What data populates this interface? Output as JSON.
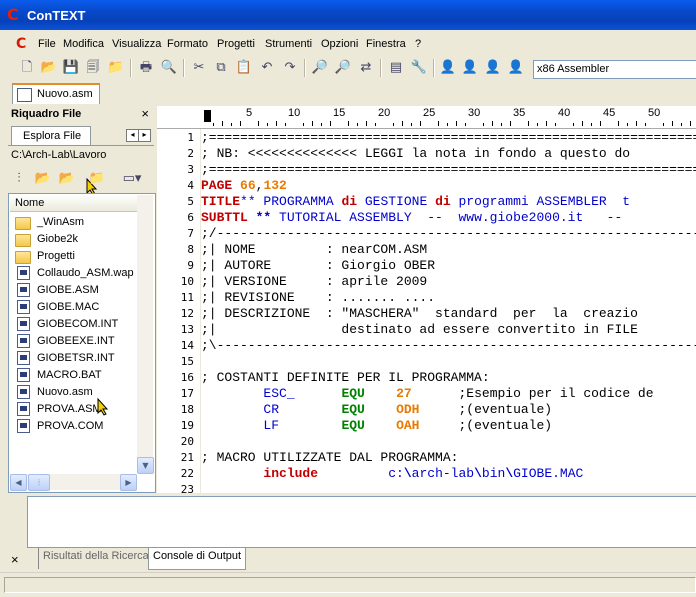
{
  "window": {
    "title": "ConTEXT",
    "app_icon": "C"
  },
  "menu": [
    "File",
    "Modifica",
    "Visualizza",
    "Formato",
    "Progetti",
    "Strumenti",
    "Opzioni",
    "Finestra",
    "?"
  ],
  "toolbar": {
    "language": "x86 Assembler"
  },
  "doc_tab": {
    "label": "Nuovo.asm"
  },
  "left_panel": {
    "title": "Riquadro File",
    "close": "×",
    "tab": "Esplora File",
    "path": "C:\\Arch-Lab\\Lavoro",
    "column_header": "Nome",
    "files": [
      {
        "name": "_WinAsm",
        "type": "folder"
      },
      {
        "name": "Giobe2k",
        "type": "folder"
      },
      {
        "name": "Progetti",
        "type": "folder"
      },
      {
        "name": "Collaudo_ASM.wap",
        "type": "file"
      },
      {
        "name": "GIOBE.ASM",
        "type": "file"
      },
      {
        "name": "GIOBE.MAC",
        "type": "file"
      },
      {
        "name": "GIOBECOM.INT",
        "type": "file"
      },
      {
        "name": "GIOBEEXE.INT",
        "type": "file"
      },
      {
        "name": "GIOBETSR.INT",
        "type": "file"
      },
      {
        "name": "MACRO.BAT",
        "type": "file"
      },
      {
        "name": "Nuovo.asm",
        "type": "file"
      },
      {
        "name": "PROVA.ASM",
        "type": "file"
      },
      {
        "name": "PROVA.COM",
        "type": "file"
      }
    ]
  },
  "ruler": {
    "numbers": [
      "5",
      "10",
      "15",
      "20",
      "25",
      "30",
      "35",
      "40",
      "45",
      "50"
    ]
  },
  "editor": {
    "line_numbers": [
      "1",
      "2",
      "3",
      "4",
      "5",
      "6",
      "7",
      "8",
      "9",
      "10",
      "11",
      "12",
      "13",
      "14",
      "15",
      "16",
      "17",
      "18",
      "19",
      "20",
      "21",
      "22",
      "23"
    ],
    "lines": [
      [
        {
          "t": ";=================================================================",
          "c": "cm"
        }
      ],
      [
        {
          "t": "; NB: <<<<<<<<<<<<<< LEGGI la nota in fondo a questo do",
          "c": "cm"
        }
      ],
      [
        {
          "t": ";=================================================================",
          "c": "cm"
        }
      ],
      [
        {
          "t": "PAGE ",
          "c": "kw"
        },
        {
          "t": "66",
          "c": "num2"
        },
        {
          "t": ",",
          "c": "cm"
        },
        {
          "t": "132",
          "c": "num2"
        }
      ],
      [
        {
          "t": "TITLE",
          "c": "kw"
        },
        {
          "t": "** PROGRAMMA ",
          "c": "bl"
        },
        {
          "t": "di",
          "c": "kw"
        },
        {
          "t": " GESTIONE ",
          "c": "bl"
        },
        {
          "t": "di",
          "c": "kw"
        },
        {
          "t": " programmi ASSEMBLER  t",
          "c": "bl"
        }
      ],
      [
        {
          "t": "SUBTTL",
          "c": "kw"
        },
        {
          "t": " ** ",
          "c": "bb"
        },
        {
          "t": "TUTORIAL ASSEMBLY  --  www.giobe2000.it   --",
          "c": "bl"
        }
      ],
      [
        {
          "t": ";/----------------------------------------------------------------",
          "c": "cm"
        }
      ],
      [
        {
          "t": ";| NOME         : nearCOM.ASM",
          "c": "cm"
        }
      ],
      [
        {
          "t": ";| AUTORE       : Giorgio OBER",
          "c": "cm"
        }
      ],
      [
        {
          "t": ";| VERSIONE     : aprile 2009",
          "c": "cm"
        }
      ],
      [
        {
          "t": ";| REVISIONE    : ....... ....",
          "c": "cm"
        }
      ],
      [
        {
          "t": ";| DESCRIZIONE  : \"MASCHERA\"  standard  per  la  creazio",
          "c": "cm"
        }
      ],
      [
        {
          "t": ";|                destinato ad essere convertito in FILE",
          "c": "cm"
        }
      ],
      [
        {
          "t": ";\\---------------------------------------------------------------",
          "c": "cm"
        }
      ],
      [
        {
          "t": "",
          "c": "cm"
        }
      ],
      [
        {
          "t": "; COSTANTI DEFINITE PER IL PROGRAMMA:",
          "c": "cm"
        }
      ],
      [
        {
          "t": "        ",
          "c": "cm"
        },
        {
          "t": "ESC_",
          "c": "bl"
        },
        {
          "t": "      ",
          "c": "cm"
        },
        {
          "t": "EQU",
          "c": "eq"
        },
        {
          "t": "    ",
          "c": "cm"
        },
        {
          "t": "27",
          "c": "hex"
        },
        {
          "t": "      ;Esempio per il codice de",
          "c": "cm"
        }
      ],
      [
        {
          "t": "        ",
          "c": "cm"
        },
        {
          "t": "CR",
          "c": "bl"
        },
        {
          "t": "        ",
          "c": "cm"
        },
        {
          "t": "EQU",
          "c": "eq"
        },
        {
          "t": "    ",
          "c": "cm"
        },
        {
          "t": "ODH",
          "c": "hex"
        },
        {
          "t": "     ;(eventuale)",
          "c": "cm"
        }
      ],
      [
        {
          "t": "        ",
          "c": "cm"
        },
        {
          "t": "LF",
          "c": "bl"
        },
        {
          "t": "        ",
          "c": "cm"
        },
        {
          "t": "EQU",
          "c": "eq"
        },
        {
          "t": "    ",
          "c": "cm"
        },
        {
          "t": "OAH",
          "c": "hex"
        },
        {
          "t": "     ;(eventuale)",
          "c": "cm"
        }
      ],
      [
        {
          "t": "",
          "c": "cm"
        }
      ],
      [
        {
          "t": "; MACRO UTILIZZATE DAL PROGRAMMA:",
          "c": "cm"
        }
      ],
      [
        {
          "t": "        ",
          "c": "cm"
        },
        {
          "t": "include",
          "c": "kw"
        },
        {
          "t": "         ",
          "c": "cm"
        },
        {
          "t": "c:",
          "c": "bl"
        },
        {
          "t": "\\",
          "c": "bb"
        },
        {
          "t": "arch-lab",
          "c": "bl"
        },
        {
          "t": "\\",
          "c": "bb"
        },
        {
          "t": "bin",
          "c": "bl"
        },
        {
          "t": "\\",
          "c": "bb"
        },
        {
          "t": "GIOBE.MAC",
          "c": "bl"
        }
      ],
      [
        {
          "t": "",
          "c": "cm"
        }
      ]
    ]
  },
  "output_panel": {
    "close": "×",
    "tabs": [
      "Risultati della Ricerca",
      "Console di Output"
    ],
    "active_tab": "Console di Output"
  }
}
